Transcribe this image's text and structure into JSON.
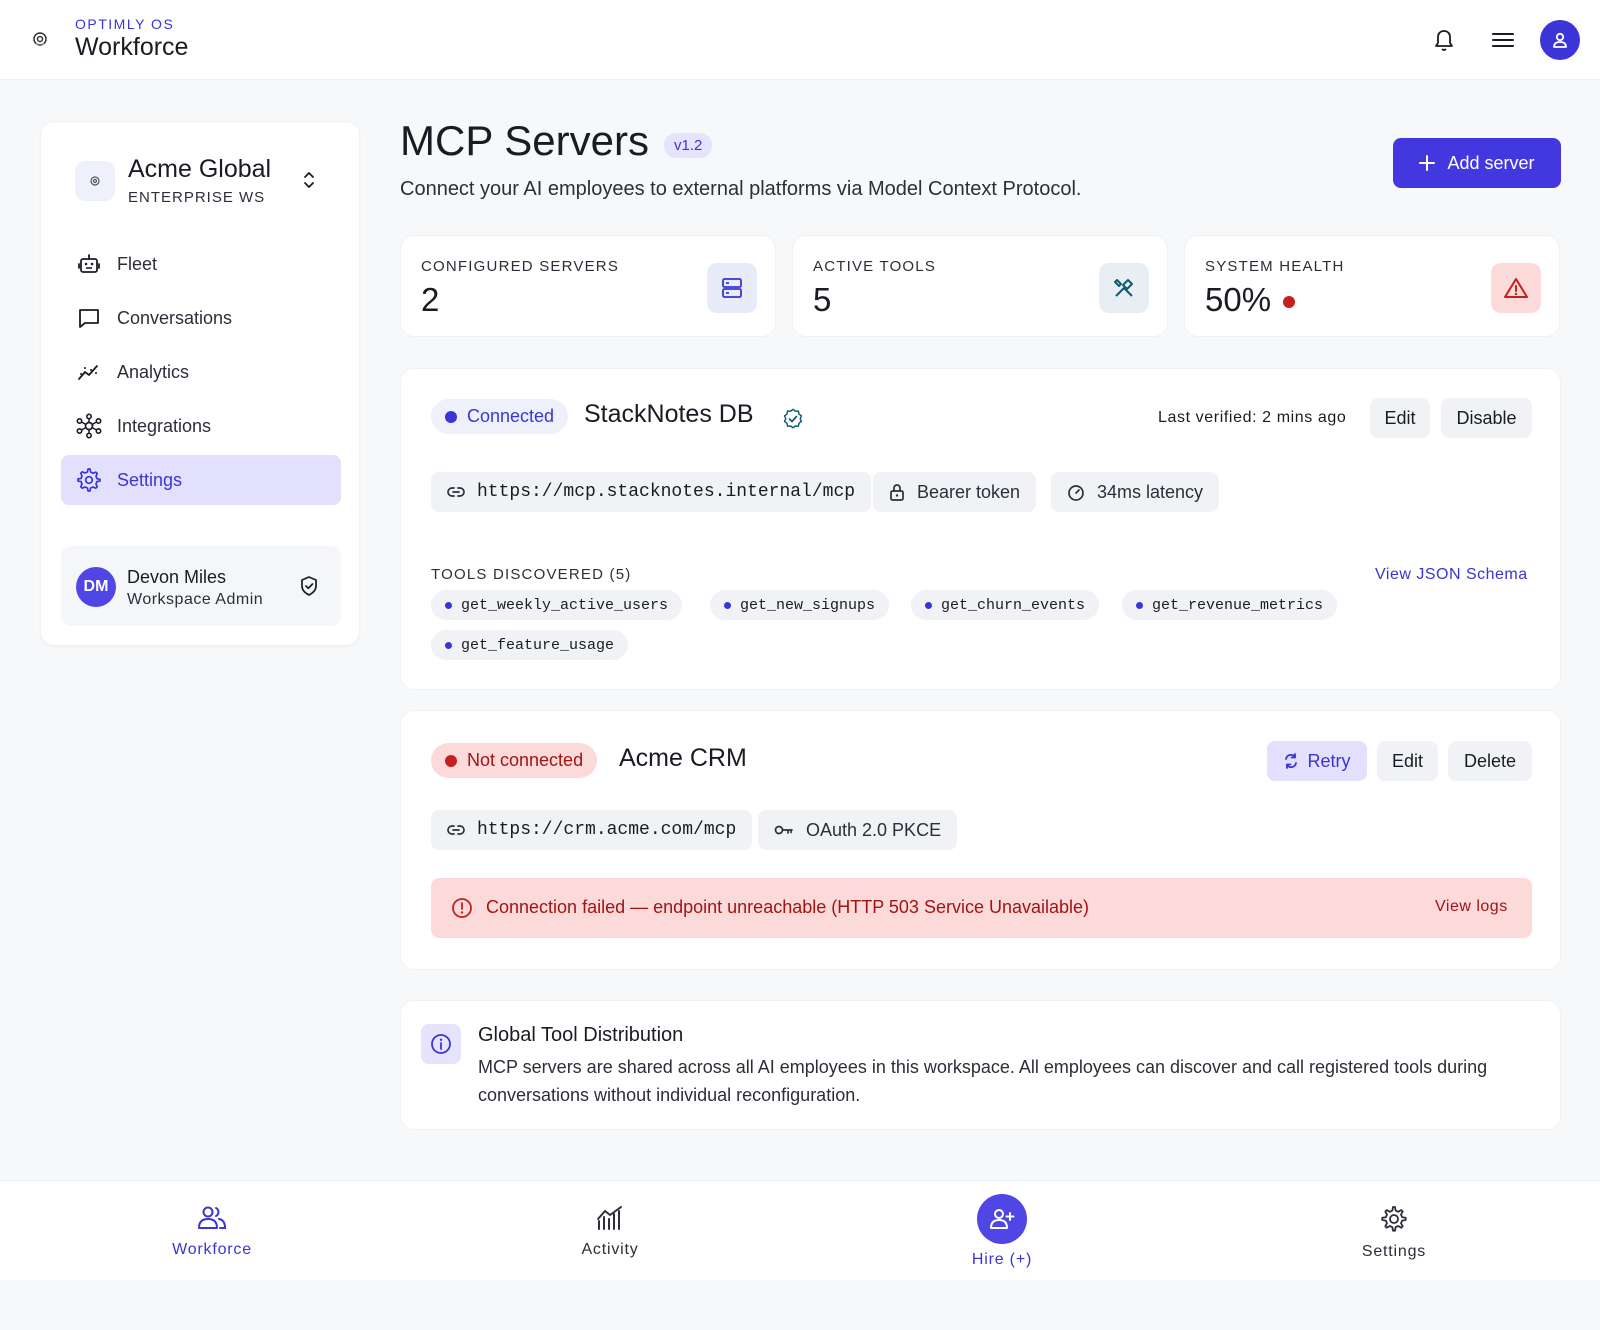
{
  "app": {
    "brand_small": "OPTIMLY OS",
    "brand_title": "Workforce"
  },
  "topbar": {
    "icons": [
      "bell-icon",
      "menu-icon",
      "user-icon"
    ]
  },
  "sidebar": {
    "workspace": {
      "name": "Acme Global",
      "subtitle": "ENTERPRISE WS"
    },
    "items": [
      {
        "label": "Fleet",
        "icon": "robot-icon"
      },
      {
        "label": "Conversations",
        "icon": "chat-icon"
      },
      {
        "label": "Analytics",
        "icon": "analytics-icon"
      },
      {
        "label": "Integrations",
        "icon": "network-icon"
      },
      {
        "label": "Settings",
        "icon": "gear-icon",
        "active": true
      }
    ],
    "user": {
      "initials": "DM",
      "name": "Devon Miles",
      "role": "Workspace Admin"
    }
  },
  "header": {
    "title": "MCP Servers",
    "version": "v1.2",
    "subtitle": "Connect your AI employees to external platforms via Model Context Protocol.",
    "add_button": "Add server"
  },
  "stats": [
    {
      "label": "CONFIGURED SERVERS",
      "value": "2",
      "icon": "server-icon"
    },
    {
      "label": "ACTIVE TOOLS",
      "value": "5",
      "icon": "tools-icon"
    },
    {
      "label": "SYSTEM HEALTH",
      "value": "50%",
      "icon": "warning-icon",
      "status_color": "#c81e1e"
    }
  ],
  "servers": [
    {
      "status": "Connected",
      "name": "StackNotes DB",
      "last_verified": "Last verified: 2 mins ago",
      "actions": [
        "Edit",
        "Disable"
      ],
      "url": "https://mcp.stacknotes.internal/mcp",
      "auth": "Bearer token",
      "latency": "34ms latency",
      "tools_label": "TOOLS DISCOVERED (5)",
      "schema_link": "View JSON Schema",
      "tools": [
        "get_weekly_active_users",
        "get_new_signups",
        "get_churn_events",
        "get_revenue_metrics",
        "get_feature_usage"
      ]
    },
    {
      "status": "Not connected",
      "name": "Acme CRM",
      "actions": [
        "Retry",
        "Edit",
        "Delete"
      ],
      "url": "https://crm.acme.com/mcp",
      "auth": "OAuth 2.0 PKCE",
      "error": "Connection failed — endpoint unreachable (HTTP 503 Service Unavailable)",
      "error_link": "View logs"
    }
  ],
  "info": {
    "title": "Global Tool Distribution",
    "body": "MCP servers are shared across all AI employees in this workspace. All employees can discover and call registered tools during conversations without individual reconfiguration."
  },
  "bottom_nav": [
    {
      "label": "Workforce",
      "icon": "users-icon",
      "active": true
    },
    {
      "label": "Activity",
      "icon": "activity-icon"
    },
    {
      "label": "Hire (+)",
      "icon": "add-user-icon"
    },
    {
      "label": "Settings",
      "icon": "gear-icon"
    }
  ],
  "colors": {
    "accent": "#4338e0",
    "danger": "#c81e1e",
    "danger_bg": "#fddada",
    "success_dot": "#3b34d6"
  }
}
